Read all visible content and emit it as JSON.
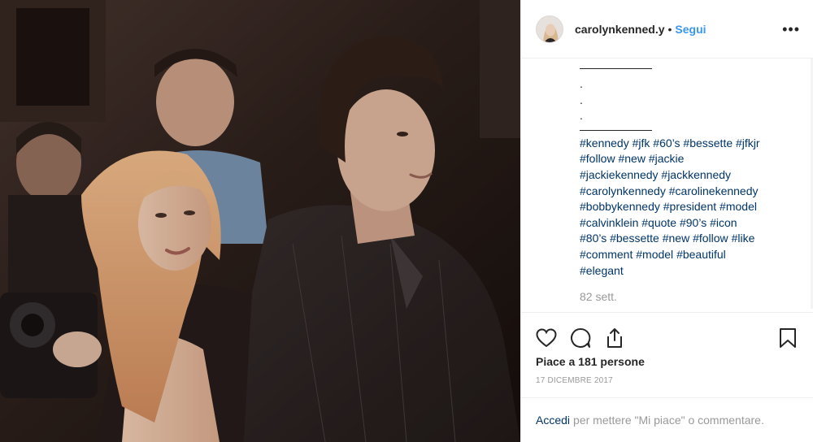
{
  "post": {
    "username": "carolynkenned.y",
    "separator": "•",
    "follow_label": "Segui",
    "more_label": "•••",
    "photo_icon": "photo-of-couple"
  },
  "caption": {
    "dots": [
      ".",
      ".",
      "."
    ],
    "hashtags": [
      "#kennedy",
      "#jfk",
      "#60’s",
      "#bessette",
      "#jfkjr",
      "#follow",
      "#new",
      "#jackie",
      "#jackiekennedy",
      "#jackkennedy",
      "#carolynkennedy",
      "#carolinekennedy",
      "#bobbykennedy",
      "#president",
      "#model",
      "#calvinklein",
      "#quote",
      "#90’s",
      "#icon",
      "#80’s",
      "#bessette",
      "#new",
      "#follow",
      "#like",
      "#comment",
      "#model",
      "#beautiful",
      "#elegant"
    ],
    "time_ago": "82 sett."
  },
  "actions": {
    "icons": [
      "heart-icon",
      "comment-icon",
      "share-icon",
      "bookmark-icon"
    ],
    "likes_text": "Piace a 181 persone",
    "date": "17 DICEMBRE 2017"
  },
  "login": {
    "link_label": "Accedi",
    "rest_text": "per mettere \"Mi piace\" o commentare."
  },
  "colors": {
    "link": "#003569",
    "follow": "#3897f0",
    "muted": "#999999",
    "text": "#262626"
  }
}
